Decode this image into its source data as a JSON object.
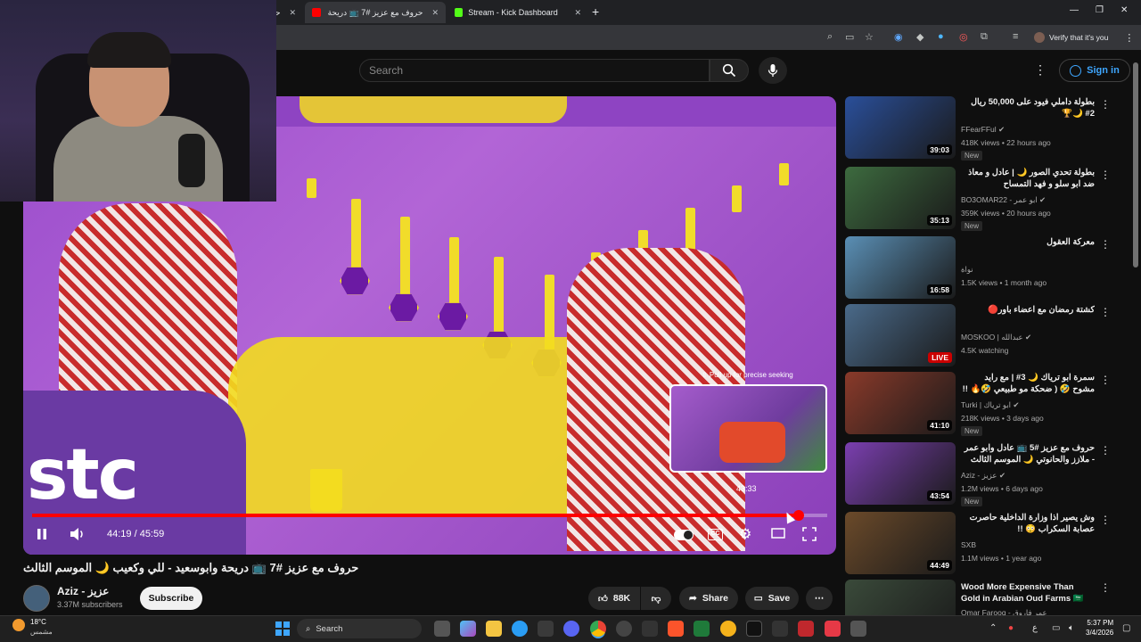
{
  "browser": {
    "tabs": [
      {
        "label": "حر",
        "active": false
      },
      {
        "label": "حروف مع عزيز #7 📺 دريحة",
        "active": true
      },
      {
        "label": "Stream - Kick Dashboard",
        "active": false
      }
    ],
    "tab_close": "✕",
    "new_tab": "+",
    "verify_label": "Verify that it's you"
  },
  "header": {
    "search_placeholder": "Search",
    "signin_label": "Sign in"
  },
  "player": {
    "seek_hint": "⇧ Pull up for precise seeking",
    "preview_time": "43:33",
    "time_display": "44:19 / 45:59",
    "progress_fraction": 0.9637,
    "overlay_text_stc": "stc"
  },
  "video": {
    "title": "حروف مع عزيز #7 📺 دريحة وابوسعيد - للي وكعيب 🌙 الموسم الثالث",
    "channel_name": "Aziz - عزيز",
    "subscribers": "3.37M subscribers",
    "subscribe_label": "Subscribe",
    "likes": "88K",
    "share_label": "Share",
    "save_label": "Save"
  },
  "recommendations": [
    {
      "title": "بطولة داملي فيود على 50,000 ريال 2# 🌙🏆",
      "channel": "FFearFFul ✔",
      "meta": "418K views • 22 hours ago",
      "badge": "New",
      "duration": "39:03",
      "live": false,
      "thumb_color": "#2a4f9a"
    },
    {
      "title": "بطولة تحدي الصور 🌙 | عادل و معاذ ضد ابو سلو و فهد التمساح",
      "channel": "BO3OMAR22 - ابو عمر ✔",
      "meta": "359K views • 20 hours ago",
      "badge": "New",
      "duration": "35:13",
      "live": false,
      "thumb_color": "#3d6b3f"
    },
    {
      "title": "معركة العقول",
      "channel": "نواة",
      "meta": "1.5K views • 1 month ago",
      "badge": "",
      "duration": "16:58",
      "live": false,
      "thumb_color": "#5a8fb5"
    },
    {
      "title": "كشتة رمضان مع اعضاء باور🔴",
      "channel": "MOSKOO | عبدالله ✔",
      "meta": "4.5K watching",
      "badge": "",
      "duration": "LIVE",
      "live": true,
      "thumb_color": "#4a6a8a"
    },
    {
      "title": "سمرة ابو ترياك 🌙 3# | مع رايد مشوح 🤣 ( ضحكة مو طبيعي 🤣🔥 !! )",
      "channel": "Turki | ابو ترياك ✔",
      "meta": "218K views • 3 days ago",
      "badge": "New",
      "duration": "41:10",
      "live": false,
      "thumb_color": "#8a3a2a"
    },
    {
      "title": "حروف مع عزيز #5 📺 عادل وابو عمر - ملازز والحانوتي 🌙 الموسم الثالث",
      "channel": "Aziz - عزيز ✔",
      "meta": "1.2M views • 6 days ago",
      "badge": "New",
      "duration": "43:54",
      "live": false,
      "thumb_color": "#7b3fb0"
    },
    {
      "title": "وش يصير اذا وزارة الداخلية حاصرت عصابة السكراب 😳 !!",
      "channel": "SXB",
      "meta": "1.1M views • 1 year ago",
      "badge": "",
      "duration": "44:49",
      "live": false,
      "thumb_color": "#6b4a2a"
    },
    {
      "title": "Wood More Expensive Than Gold in Arabian Oud Farms 🇸🇦",
      "channel": "Omar Farooq - عمر فاروق",
      "meta": "",
      "badge": "",
      "duration": "",
      "live": false,
      "thumb_color": "#3a4a3a"
    }
  ],
  "taskbar": {
    "temperature": "18°C",
    "weather_condition": "مشمس",
    "search_label": "Search",
    "time": "5:37 PM",
    "date": "3/4/2026"
  },
  "colors": {
    "accent": "#ff0000",
    "link": "#3ea6ff",
    "background": "#0f0f0f"
  }
}
